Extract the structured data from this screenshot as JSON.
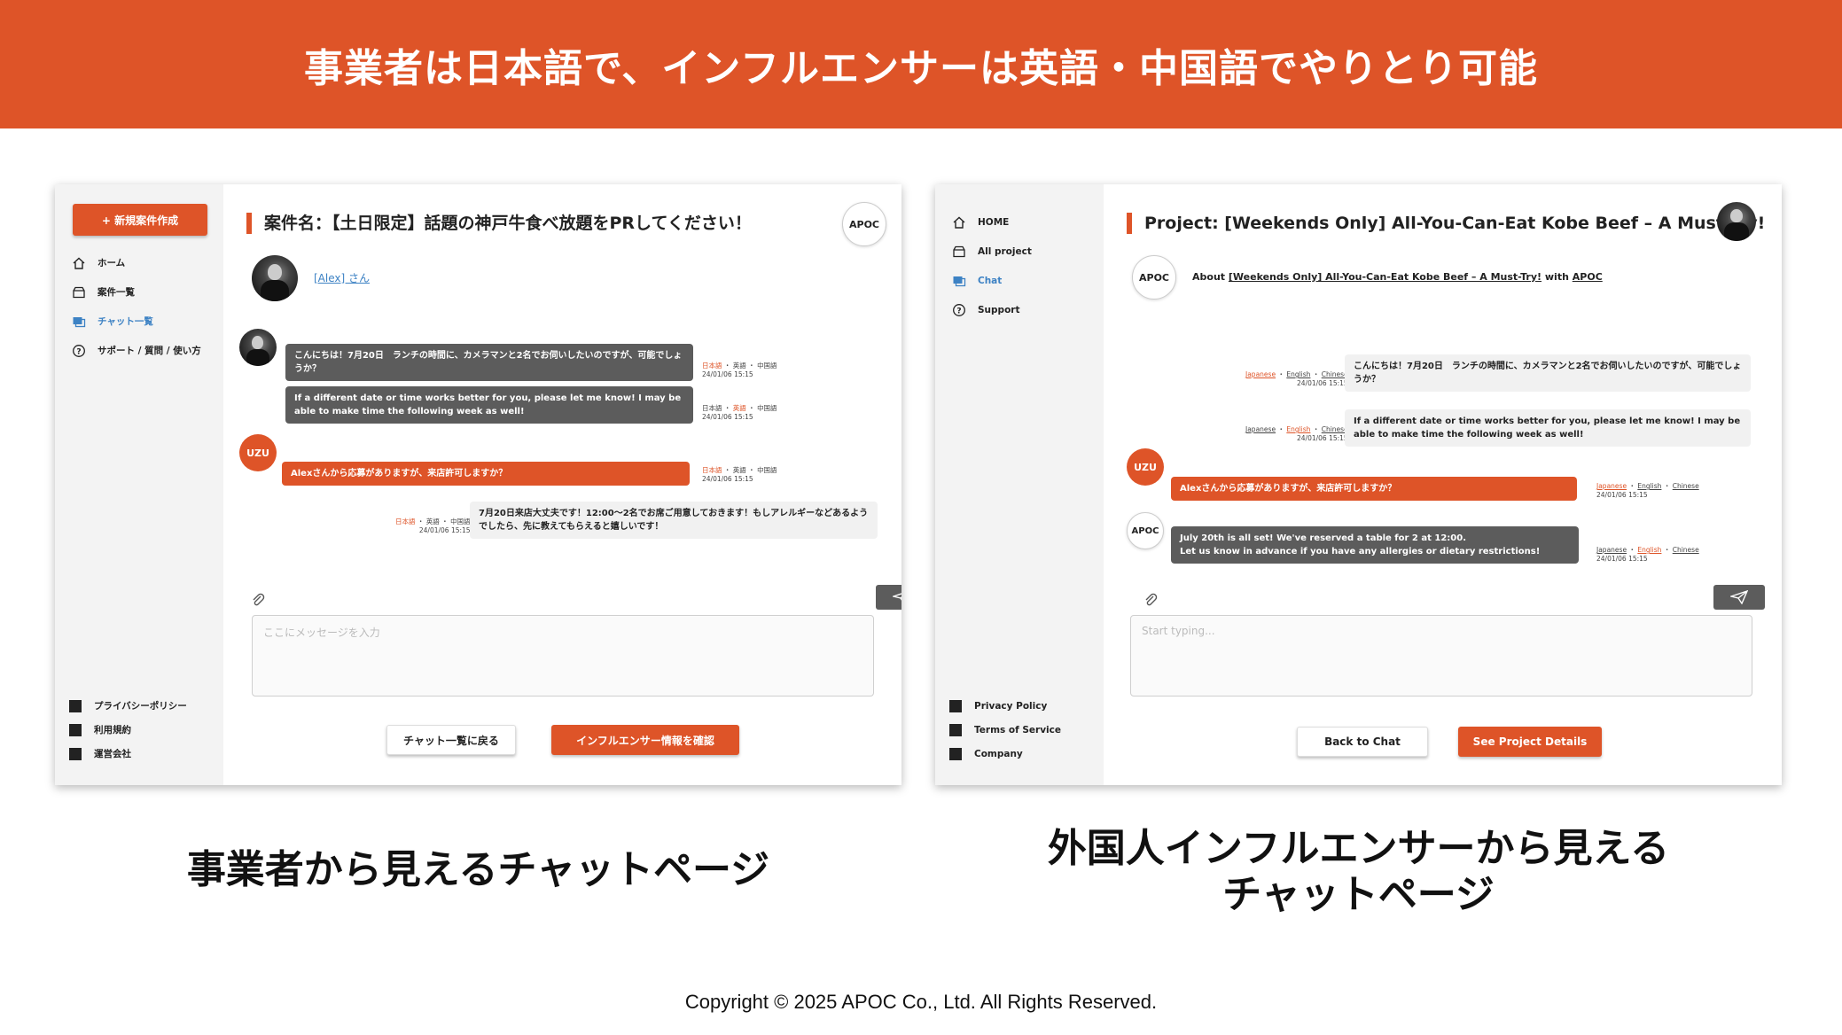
{
  "banner": {
    "title": "事業者は日本語で、インフルエンサーは英語・中国語でやりとり可能"
  },
  "left": {
    "new_button": "+ 新規案件作成",
    "nav": [
      "ホーム",
      "案件一覧",
      "チャット一覧",
      "サポート / 質問 / 使い方"
    ],
    "footer": [
      "プライバシーポリシー",
      "利用規約",
      "運営会社"
    ],
    "title": "案件名：【土日限定】話題の神戸牛食べ放題をPRしてください！",
    "apoc": "APOC",
    "user": "[Alex] さん",
    "uzu": "UZU",
    "messages": [
      {
        "text": "こんにちは！7月20日　ランチの時間に、カメラマンと2名でお伺いしたいのですが、可能でしょうか？",
        "lang1": "日本語",
        "lang2": "英語",
        "lang3": "中国語",
        "time": "24/01/06 15:15"
      },
      {
        "text": "If a different date or time works better for you, please let me know! I may be able to make time the following week as well!",
        "lang1": "日本語",
        "lang2": "英語",
        "lang3": "中国語",
        "time": "24/01/06 15:15"
      },
      {
        "text": "Alexさんから応募がありますが、来店許可しますか？",
        "lang1": "日本語",
        "lang2": "英語",
        "lang3": "中国語",
        "time": "24/01/06 15:15"
      },
      {
        "text": "7月20日来店大丈夫です！12:00〜2名でお席ご用意しておきます！もしアレルギーなどあるようでしたら、先に教えてもらえると嬉しいです！",
        "lang1": "日本語",
        "lang2": "英語",
        "lang3": "中国語",
        "time": "24/01/06 15:15"
      }
    ],
    "placeholder": "ここにメッセージを入力",
    "back_button": "チャット一覧に戻る",
    "confirm_button": "インフルエンサー情報を確認"
  },
  "right": {
    "nav": [
      "HOME",
      "All project",
      "Chat",
      "Support"
    ],
    "footer": [
      "Privacy Policy",
      "Terms of Service",
      "Company"
    ],
    "title": "Project: [Weekends Only] All-You-Can-Eat Kobe Beef – A Must-Try!",
    "apoc": "APOC",
    "about_prefix": "About",
    "about_link": "[Weekends Only] All-You-Can-Eat Kobe Beef – A Must-Try!",
    "about_with": "with",
    "about_apoc": "APOC",
    "uzu": "UZU",
    "messages": [
      {
        "text": "こんにちは！7月20日　ランチの時間に、カメラマンと2名でお伺いしたいのですが、可能でしょうか？",
        "lang1": "Japanese",
        "lang2": "English",
        "lang3": "Chinese",
        "time": "24/01/06 15:15"
      },
      {
        "text": "If a different date or time works better for you, please let me know! I may be able to make time the following week as well!",
        "lang1": "Japanese",
        "lang2": "English",
        "lang3": "Chinese",
        "time": "24/01/06 15:15"
      },
      {
        "text": "Alexさんから応募がありますが、来店許可しますか？",
        "lang1": "Japanese",
        "lang2": "English",
        "lang3": "Chinese",
        "time": "24/01/06 15:15"
      },
      {
        "text_line1": "July 20th is all set! We've reserved a table for 2 at 12:00.",
        "text_line2": "Let us know in advance if you have any allergies or dietary restrictions!",
        "lang1": "Japanese",
        "lang2": "English",
        "lang3": "Chinese",
        "time": "24/01/06 15:15"
      }
    ],
    "placeholder": "Start typing...",
    "back_button": "Back to Chat",
    "details_button": "See Project Details"
  },
  "captions": {
    "left": "事業者から見えるチャットページ",
    "right_line1": "外国人インフルエンサーから見える",
    "right_line2": "チャットページ"
  },
  "copyright": "Copyright © 2025 APOC Co., Ltd. All Rights Reserved."
}
